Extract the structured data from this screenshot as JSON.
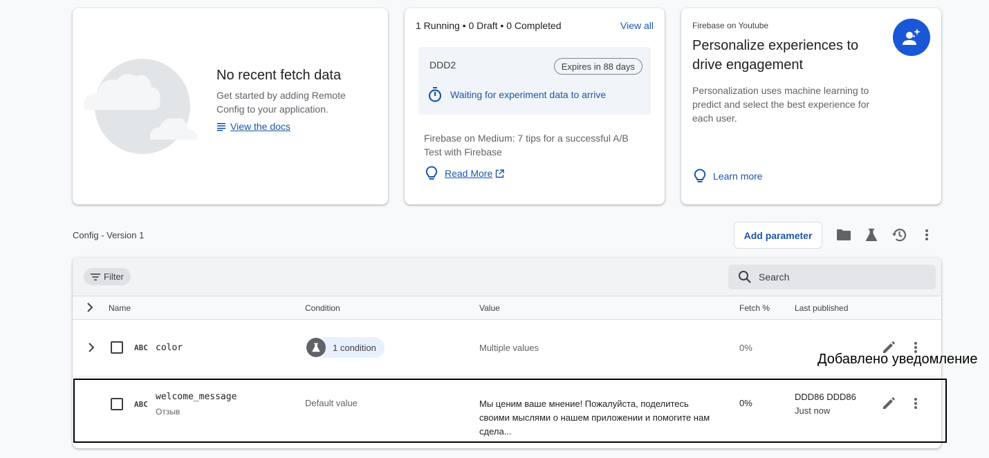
{
  "fetch_card": {
    "title": "No recent fetch data",
    "description": "Get started by adding Remote Config to your application.",
    "docs_link": "View the docs"
  },
  "experiment_card": {
    "status": "1 Running • 0 Draft • 0 Completed",
    "view_all": "View all",
    "experiment_name": "DDD2",
    "expires": "Expires in 88 days",
    "waiting": "Waiting for experiment data to arrive",
    "medium_text": "Firebase on Medium: 7 tips for a successful A/B Test with Firebase",
    "read_more": "Read More"
  },
  "youtube_card": {
    "source": "Firebase on Youtube",
    "heading": "Personalize experiences to drive engagement",
    "body": "Personalization uses machine learning to predict and select the best experience for each user.",
    "learn_more": "Learn more"
  },
  "config": {
    "version_label": "Config - Version 1",
    "add_parameter": "Add parameter",
    "toolbar_icons": [
      "folder-icon",
      "flask-icon",
      "history-icon",
      "more-vert-icon"
    ]
  },
  "table": {
    "filter_label": "Filter",
    "search_placeholder": "Search",
    "headers": {
      "name": "Name",
      "condition": "Condition",
      "value": "Value",
      "fetch": "Fetch %",
      "published": "Last published"
    },
    "rows": [
      {
        "type": "ABC",
        "name": "color",
        "condition": "1 condition",
        "value": "Multiple values",
        "fetch": "0%"
      },
      {
        "type": "ABC",
        "name": "welcome_message",
        "description": "Отзыв",
        "condition": "Default value",
        "value": "Мы ценим ваше мнение! Пожалуйста, поделитесь своими мыслями о нашем приложении и помогите нам сдела...",
        "fetch": "0%",
        "published_by": "DDD86 DDD86",
        "published_when": "Just now"
      }
    ]
  },
  "annotation": {
    "notice": "Добавлено уведомление"
  },
  "colors": {
    "link": "#1a56a8",
    "badge": "#1a56d6",
    "highlight_border": "#000000"
  }
}
